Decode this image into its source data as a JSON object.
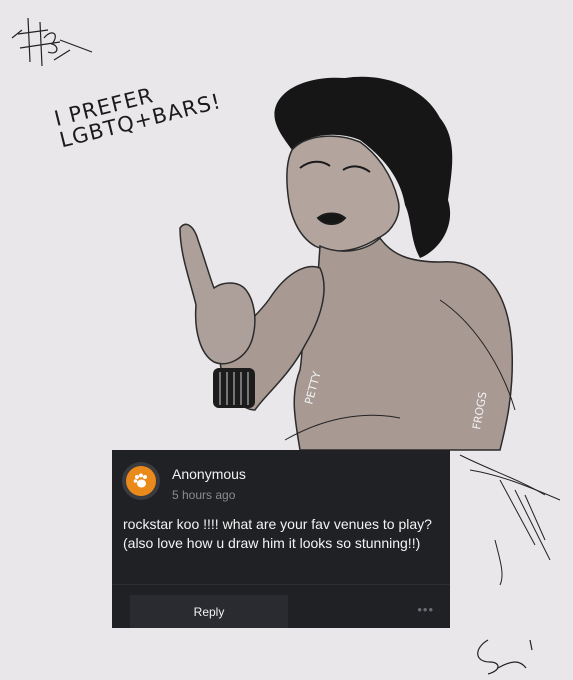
{
  "artwork": {
    "speech_text": "I PREFER\nLGBTQ+BARS!",
    "tattoo_words": [
      "PETTY",
      "FROGS"
    ]
  },
  "ask_card": {
    "icon": "paw-icon",
    "sender_name": "Anonymous",
    "timestamp": "5 hours ago",
    "message": "rockstar koo !!!! what are your fav venues to play? (also love how u draw him it looks so stunning!!)",
    "reply_label": "Reply",
    "more_label": "•••",
    "accent_color": "#e98a1a",
    "background_color": "#202125"
  }
}
